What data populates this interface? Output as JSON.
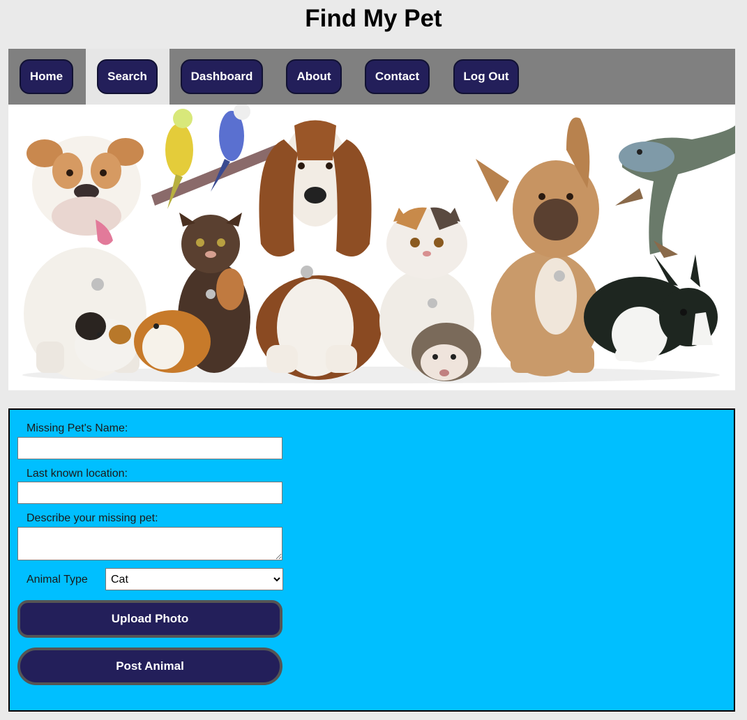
{
  "header": {
    "title": "Find My Pet"
  },
  "nav": {
    "active": "Search",
    "items": [
      {
        "label": "Home"
      },
      {
        "label": "Search"
      },
      {
        "label": "Dashboard"
      },
      {
        "label": "About"
      },
      {
        "label": "Contact"
      },
      {
        "label": "Log Out"
      }
    ]
  },
  "hero": {
    "animals": [
      "bulldog",
      "parakeets",
      "tortoiseshell-kitten",
      "basset-hound",
      "calico-exotic-cat",
      "french-bulldog",
      "iguana",
      "guinea-pigs",
      "hedgehog",
      "dutch-rabbit"
    ]
  },
  "form": {
    "name_label": "Missing Pet's Name:",
    "name_value": "",
    "location_label": "Last known location:",
    "location_value": "",
    "description_label": "Describe your missing pet:",
    "description_value": "",
    "animal_type_label": "Animal Type",
    "animal_type_selected": "Cat",
    "upload_label": "Upload Photo",
    "post_label": "Post Animal"
  },
  "colors": {
    "page_bg": "#eaeaea",
    "nav_bg": "#808080",
    "nav_active_bg": "#e6e6e6",
    "button_bg": "#231f5a",
    "form_bg": "#00bfff"
  }
}
